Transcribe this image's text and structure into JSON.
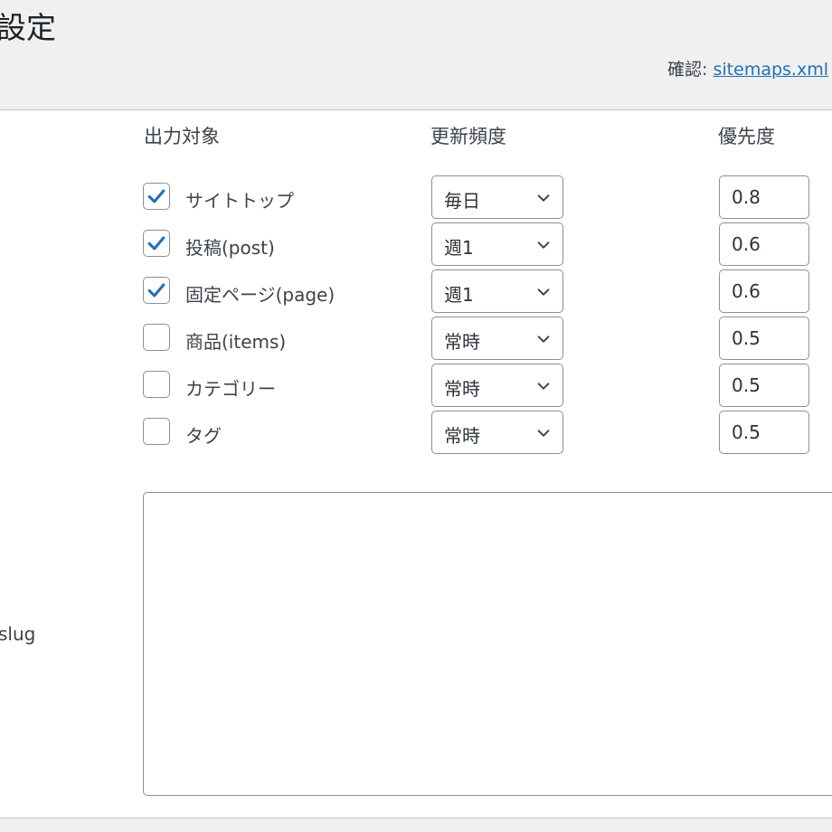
{
  "header": {
    "title": "設定",
    "confirm_label": "確認:",
    "confirm_link": "sitemaps.xml"
  },
  "columns": {
    "target": "出力対象",
    "frequency": "更新頻度",
    "priority": "優先度"
  },
  "rows": [
    {
      "label": "サイトトップ",
      "checked": true,
      "frequency": "毎日",
      "priority": "0.8"
    },
    {
      "label": "投稿(post)",
      "checked": true,
      "frequency": "週1",
      "priority": "0.6"
    },
    {
      "label": "固定ページ(page)",
      "checked": true,
      "frequency": "週1",
      "priority": "0.6"
    },
    {
      "label": "商品(items)",
      "checked": false,
      "frequency": "常時",
      "priority": "0.5"
    },
    {
      "label": "カテゴリー",
      "checked": false,
      "frequency": "常時",
      "priority": "0.5"
    },
    {
      "label": "タグ",
      "checked": false,
      "frequency": "常時",
      "priority": "0.5"
    }
  ],
  "slug_section": {
    "label": "slug",
    "value": ""
  },
  "colors": {
    "accent": "#2271b1",
    "background": "#f0f0f1",
    "border": "#8c8f94"
  }
}
